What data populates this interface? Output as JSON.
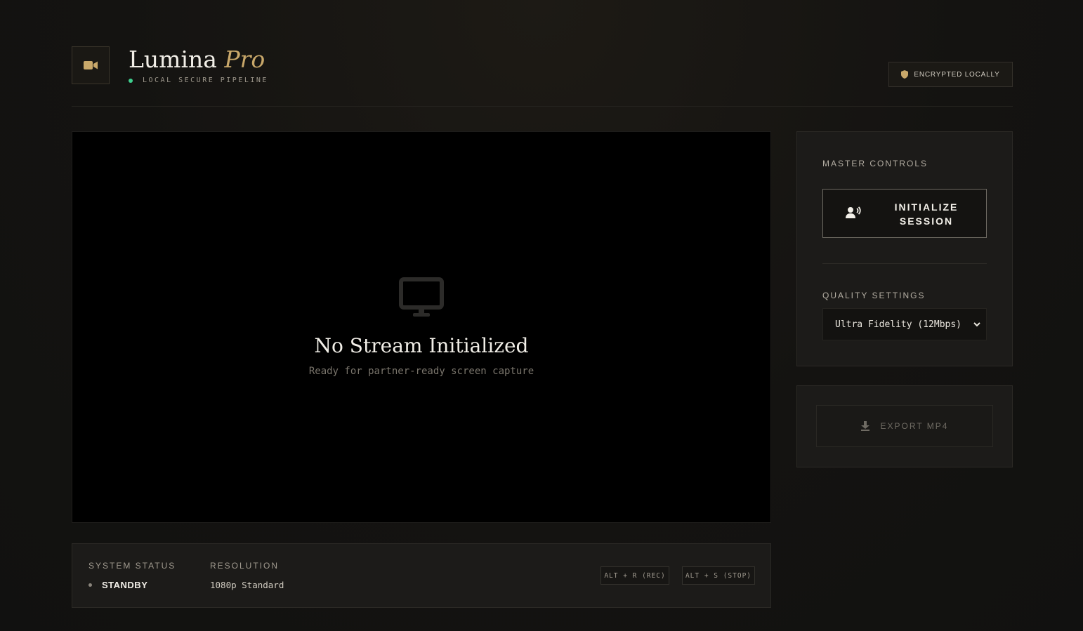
{
  "header": {
    "title": "Lumina",
    "title_accent": "Pro",
    "subtitle": "LOCAL SECURE PIPELINE",
    "badge": "ENCRYPTED LOCALLY",
    "logo_icon": "video-camera-icon",
    "badge_icon": "shield-icon"
  },
  "preview": {
    "icon": "monitor-icon",
    "title": "No Stream Initialized",
    "subtitle": "Ready for partner-ready screen capture"
  },
  "status": {
    "system_status_label": "SYSTEM STATUS",
    "system_status_value": "STANDBY",
    "resolution_label": "RESOLUTION",
    "resolution_value": "1080p Standard",
    "shortcut_record": "ALT + R (REC)",
    "shortcut_stop": "ALT + S (STOP)"
  },
  "controls": {
    "section_label": "MASTER CONTROLS",
    "init_line1": "INITIALIZE",
    "init_line2": "SESSION",
    "init_icon": "user-voice-icon",
    "quality_label": "QUALITY SETTINGS",
    "quality_selected": "Ultra Fidelity (12Mbps)"
  },
  "export": {
    "label": "EXPORT MP4",
    "icon": "download-icon"
  },
  "colors": {
    "accent": "#c9a86a",
    "status_green": "#3ecf8e",
    "background": "#141311"
  }
}
